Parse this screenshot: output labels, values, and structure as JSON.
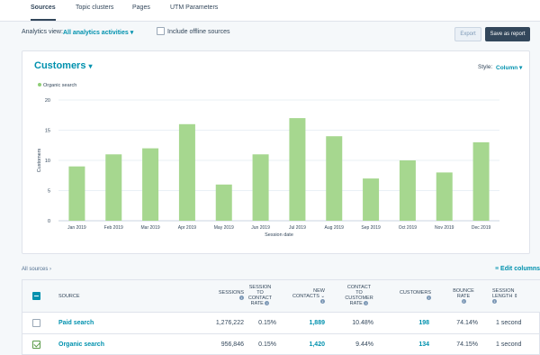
{
  "tabs": [
    {
      "label": "Sources",
      "active": true
    },
    {
      "label": "Topic clusters",
      "active": false
    },
    {
      "label": "Pages",
      "active": false
    },
    {
      "label": "UTM Parameters",
      "active": false
    }
  ],
  "toolbar": {
    "analytics_label": "Analytics view:",
    "analytics_value": "All analytics activities",
    "offline_label": "Include offline sources",
    "export_label": "Export",
    "save_label": "Save as report"
  },
  "card": {
    "title": "Customers",
    "style_label": "Style:",
    "style_value": "Column"
  },
  "chart_data": {
    "type": "bar",
    "title": "",
    "xlabel": "Session date",
    "ylabel": "Customers",
    "ylim": [
      0,
      20
    ],
    "yticks": [
      0,
      5,
      10,
      15,
      20
    ],
    "grid": true,
    "legend": "top-left",
    "color": "#a6d78f",
    "series": [
      {
        "name": "Organic search",
        "values": [
          9,
          11,
          12,
          16,
          6,
          11,
          17,
          14,
          7,
          10,
          8,
          13
        ]
      }
    ],
    "categories": [
      "Jan 2019",
      "Feb 2019",
      "Mar 2019",
      "Apr 2019",
      "May 2019",
      "Jun 2019",
      "Jul 2019",
      "Aug 2019",
      "Sep 2019",
      "Oct 2019",
      "Nov 2019",
      "Dec 2019"
    ]
  },
  "breadcrumb": "All sources",
  "edit_columns": "Edit columns",
  "table": {
    "headers": {
      "source": "SOURCE",
      "sessions": "SESSIONS",
      "s2c_1": "SESSION",
      "s2c_2": "TO",
      "s2c_3": "CONTACT",
      "s2c_4": "RATE",
      "nc_1": "NEW",
      "nc_2": "CONTACTS",
      "c2c_1": "CONTACT",
      "c2c_2": "TO",
      "c2c_3": "CUSTOMER",
      "c2c_4": "RATE",
      "customers": "CUSTOMERS",
      "br_1": "BOUNCE",
      "br_2": "RATE",
      "sl_1": "SESSION",
      "sl_2": "LENGTH"
    },
    "rows": [
      {
        "source": "Paid search",
        "sessions": "1,276,222",
        "session_to_contact": "0.15%",
        "new_contacts": "1,889",
        "contact_to_customer": "10.48%",
        "customers": "198",
        "bounce_rate": "74.14%",
        "session_length": "1 second",
        "checked": false
      },
      {
        "source": "Organic search",
        "sessions": "956,846",
        "session_to_contact": "0.15%",
        "new_contacts": "1,420",
        "contact_to_customer": "9.44%",
        "customers": "134",
        "bounce_rate": "74.15%",
        "session_length": "1 second",
        "checked": true
      }
    ]
  }
}
